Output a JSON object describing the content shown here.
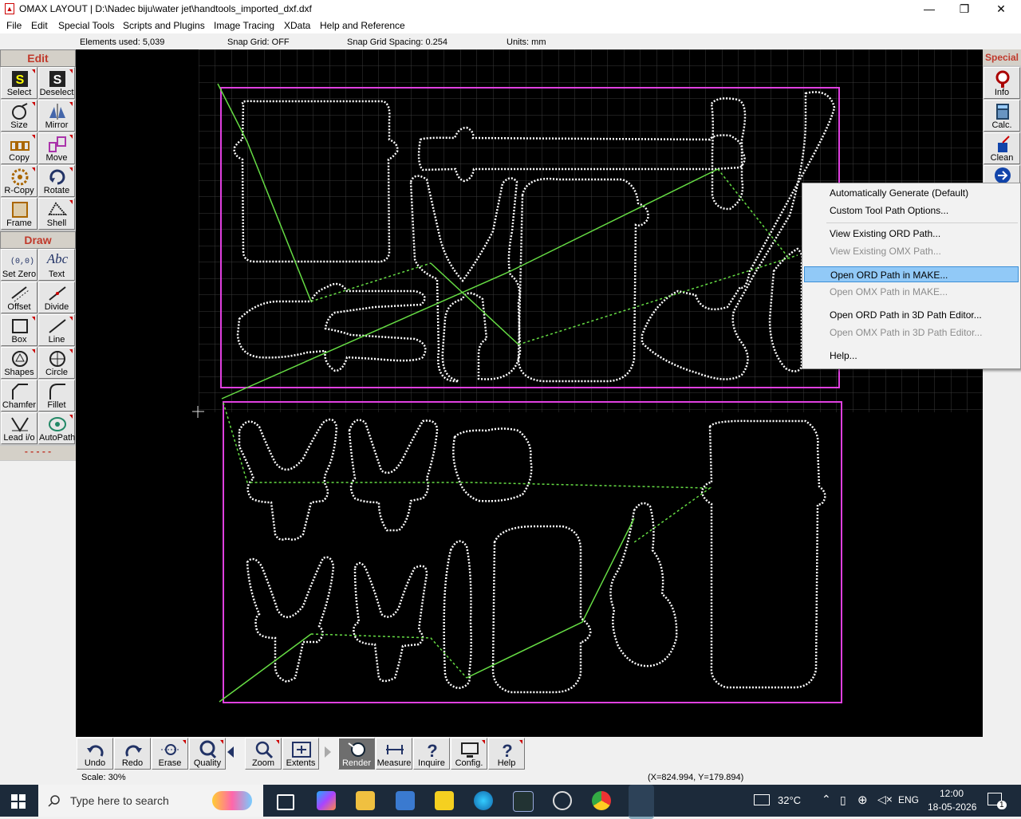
{
  "window": {
    "title": "OMAX LAYOUT | D:\\Nadec biju\\water jet\\handtools_imported_dxf.dxf",
    "minimize": "—",
    "restore": "❐",
    "close": "✕"
  },
  "menu": [
    "File",
    "Edit",
    "Special Tools",
    "Scripts and Plugins",
    "Image Tracing",
    "XData",
    "Help and Reference"
  ],
  "status": {
    "elements": "Elements used: 5,039",
    "snap_grid": "Snap Grid: OFF",
    "snap_spacing": "Snap Grid Spacing: 0.254",
    "units": "Units: mm"
  },
  "left_panel": {
    "edit_header": "Edit",
    "draw_header": "Draw",
    "edit_tools": [
      "Select",
      "Deselect",
      "Size",
      "Mirror",
      "Copy",
      "Move",
      "R-Copy",
      "Rotate",
      "Frame",
      "Shell"
    ],
    "draw_tools": [
      "Set Zero",
      "Text",
      "Offset",
      "Divide",
      "Box",
      "Line",
      "Shapes",
      "Circle",
      "Chamfer",
      "Fillet",
      "Lead i/o",
      "AutoPath"
    ],
    "more": "- - - - -",
    "set_zero_glyph": "(0,0)",
    "text_glyph": "Abc"
  },
  "right_panel": {
    "header": "Special",
    "tools": [
      "Info",
      "Calc.",
      "Clean"
    ]
  },
  "context_menu": {
    "items": [
      {
        "label": "Automatically Generate (Default)",
        "enabled": true
      },
      {
        "label": "Custom Tool Path Options...",
        "enabled": true
      },
      {
        "label": "View Existing ORD Path...",
        "enabled": true
      },
      {
        "label": "View Existing OMX Path...",
        "enabled": false
      },
      {
        "label": "Open ORD Path in MAKE...",
        "enabled": true,
        "highlighted": true
      },
      {
        "label": "Open OMX Path in MAKE...",
        "enabled": false
      },
      {
        "label": "Open ORD Path in 3D Path Editor...",
        "enabled": true
      },
      {
        "label": "Open OMX Path in 3D Path Editor...",
        "enabled": false
      },
      {
        "label": "Help...",
        "enabled": true
      }
    ]
  },
  "bottom_tools": [
    "Undo",
    "Redo",
    "Erase",
    "Quality",
    "Zoom",
    "Extents",
    "Render",
    "Measure",
    "Inquire",
    "Config.",
    "Help"
  ],
  "bottom_status": {
    "scale": "Scale: 30%",
    "coords": "(X=824.994, Y=179.894)"
  },
  "taskbar": {
    "search_placeholder": "Type here to search",
    "temperature": "32°C",
    "language": "ENG",
    "time": "12:00",
    "date": "18-05-2026",
    "notifications": "1"
  },
  "colors": {
    "canvas": "#000000",
    "part_outline": "#ffffff",
    "frame": "#e040e0",
    "traverse": "#66dd44",
    "menu_highlight": "#91c9f7"
  }
}
